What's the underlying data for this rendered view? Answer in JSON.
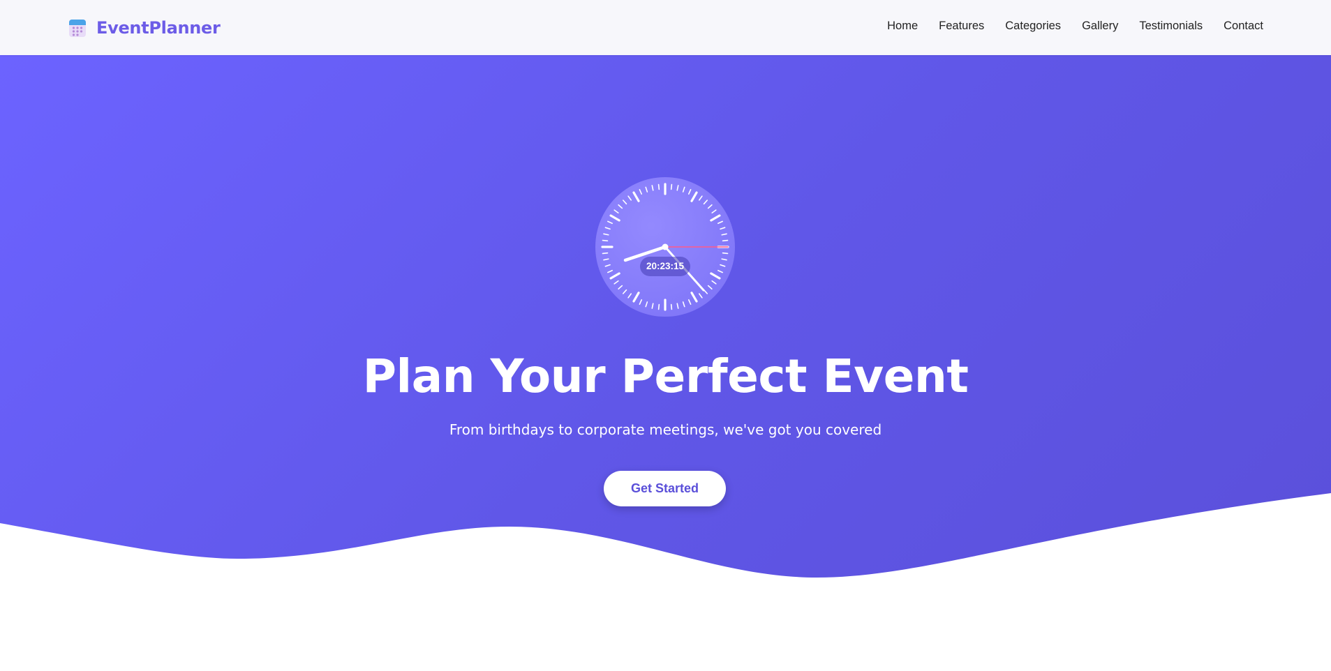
{
  "brand": {
    "name": "EventPlanner",
    "icon": "calendar-icon",
    "color": "#6c5ce7"
  },
  "nav": {
    "links": [
      "Home",
      "Features",
      "Categories",
      "Gallery",
      "Testimonials",
      "Contact"
    ]
  },
  "hero": {
    "clock_time": "20:23:15",
    "title": "Plan Your Perfect Event",
    "subtitle": "From birthdays to corporate meetings, we've got you covered",
    "cta_label": "Get Started",
    "gradient_start": "#6c63ff",
    "gradient_end": "#5a4fd9"
  }
}
